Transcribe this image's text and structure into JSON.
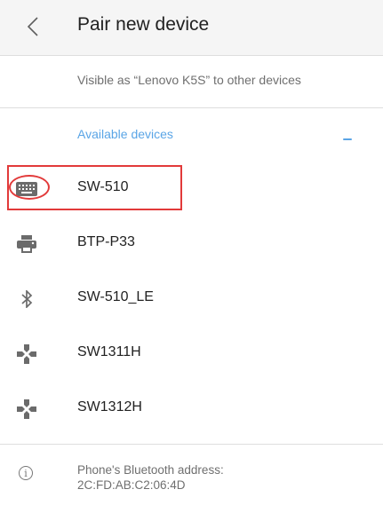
{
  "appbar": {
    "back_icon": "chevron-left-icon",
    "title": "Pair new device"
  },
  "visibility_text": "Visible as “Lenovo K5S” to other devices",
  "available_devices": {
    "header": "Available devices",
    "accent_color": "#5aa5e6",
    "devices": [
      {
        "name": "SW-510",
        "icon": "keyboard-icon",
        "highlighted": true
      },
      {
        "name": "BTP-P33",
        "icon": "printer-icon"
      },
      {
        "name": "SW-510_LE",
        "icon": "bluetooth-icon"
      },
      {
        "name": "SW1311H",
        "icon": "gamepad-icon"
      },
      {
        "name": "SW1312H",
        "icon": "gamepad-icon"
      }
    ]
  },
  "footer": {
    "info_icon": "info-icon",
    "address_line1": "Phone's Bluetooth address:",
    "address_line2": "2C:FD:AB:C2:06:4D"
  },
  "annotation_color": "#e23a3a"
}
